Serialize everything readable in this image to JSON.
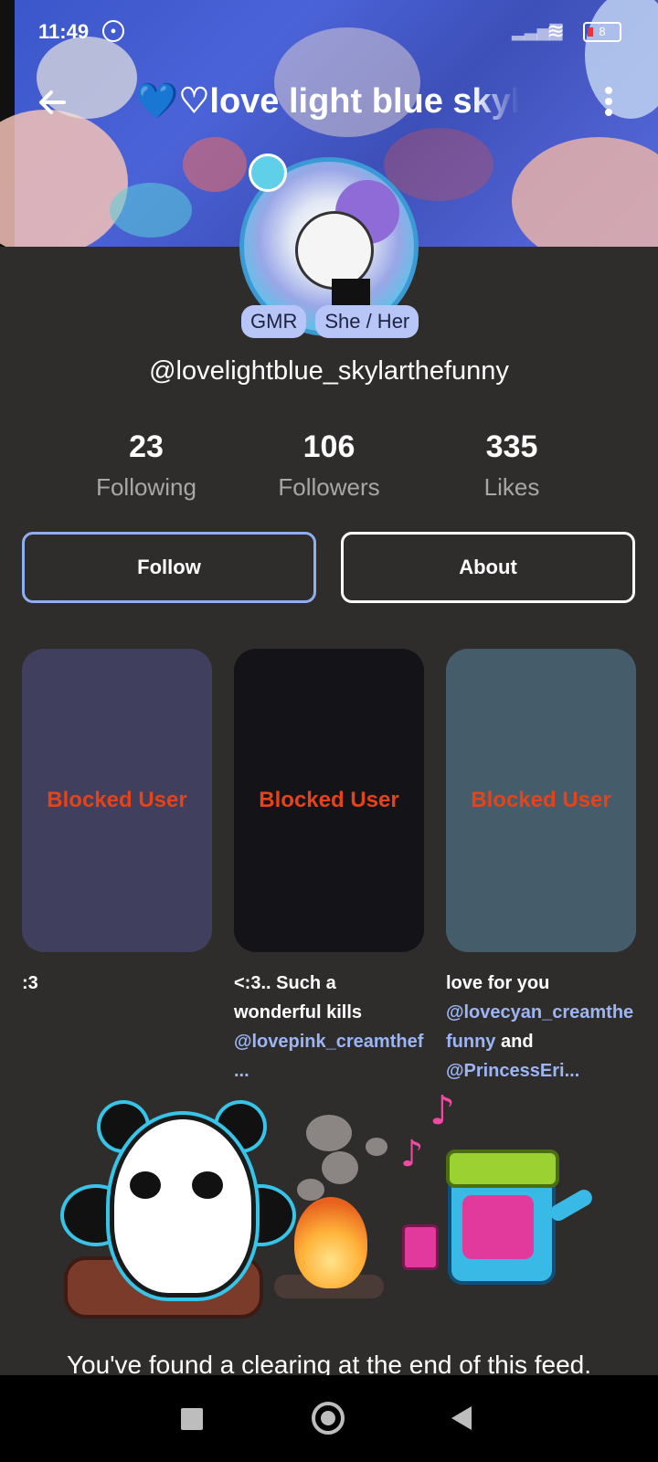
{
  "status_bar": {
    "time": "11:49",
    "battery": "8"
  },
  "header": {
    "title": "💙♡love light blue skyl",
    "back_icon": "arrow-left-icon",
    "more_icon": "more-vertical-icon"
  },
  "profile": {
    "tags": [
      "GMR",
      "She / Her"
    ],
    "username": "@lovelightblue_skylarthefunny",
    "stats": [
      {
        "value": "23",
        "label": "Following"
      },
      {
        "value": "106",
        "label": "Followers"
      },
      {
        "value": "335",
        "label": "Likes"
      }
    ],
    "buttons": {
      "follow": "Follow",
      "about": "About"
    }
  },
  "posts": [
    {
      "overlay": "Blocked User",
      "caption_text": ":3",
      "mention": "",
      "caption_after": "",
      "mention2": ""
    },
    {
      "overlay": "Blocked User",
      "caption_text": "<:3.. Such a wonderful kills ",
      "mention": "@lovepink_creamthef...",
      "caption_after": "",
      "mention2": ""
    },
    {
      "overlay": "Blocked User",
      "caption_text": "love for you ",
      "mention": "@lovecyan_creamthefunny",
      "caption_after": " and ",
      "mention2": "@PrincessEri..."
    }
  ],
  "feed_end": {
    "text": "You've found a clearing at the end of this feed."
  },
  "colors": {
    "background": "#2f2d2c",
    "accent_border": "#8fb0f0",
    "blocked_text": "#e6431a",
    "mention": "#9bb5f5",
    "tag_bg": "#b8c6f7"
  }
}
